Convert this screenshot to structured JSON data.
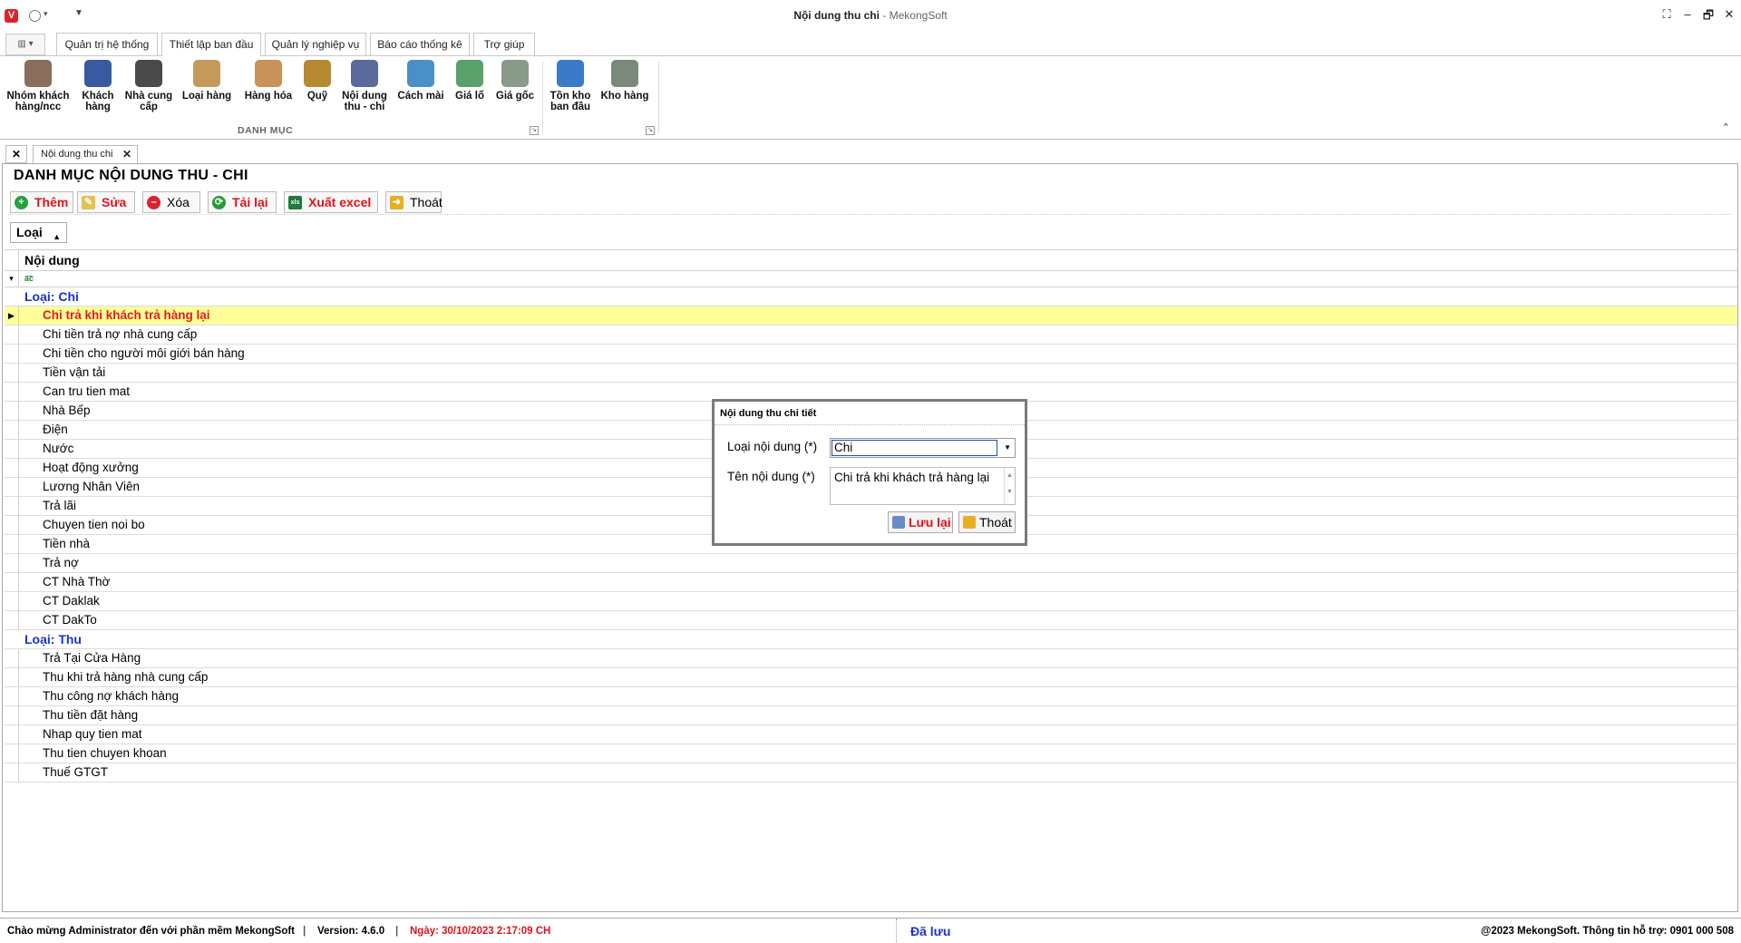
{
  "window": {
    "title": "Nội dung thu chi",
    "app_name": "MekongSoft",
    "separator": " - ",
    "controls": [
      "⛶",
      "–",
      "🗗",
      "✕"
    ]
  },
  "ribbon_tabs": [
    {
      "label": "Quản trị hệ thống"
    },
    {
      "label": "Thiết lập ban đầu",
      "active": true
    },
    {
      "label": "Quản lý nghiệp vụ"
    },
    {
      "label": "Báo cáo thống kê"
    },
    {
      "label": "Trợ giúp"
    }
  ],
  "ribbon": {
    "group_label": "DANH MỤC",
    "buttons": [
      {
        "line1": "Nhóm khách",
        "line2": "hàng/ncc",
        "icon": "people-group-icon",
        "color": "#8a6d5a"
      },
      {
        "line1": "Khách",
        "line2": "hàng",
        "icon": "customer-icon",
        "color": "#3a5aa0"
      },
      {
        "line1": "Nhà cung",
        "line2": "cấp",
        "icon": "supplier-icon",
        "color": "#4a4a4a"
      },
      {
        "line1": "Loại hàng",
        "line2": "",
        "icon": "boxes-icon",
        "color": "#c49a5a"
      },
      {
        "line1": "Hàng hóa",
        "line2": "",
        "icon": "box-icon",
        "color": "#c8925a"
      },
      {
        "line1": "Quỹ",
        "line2": "",
        "icon": "money-bag-icon",
        "color": "#b58a30"
      },
      {
        "line1": "Nội dung",
        "line2": "thu - chi",
        "icon": "notepad-icon",
        "color": "#5a6a9a"
      },
      {
        "line1": "Cách mài",
        "line2": "",
        "icon": "tools-icon",
        "color": "#4a90c8"
      },
      {
        "line1": "Giá lố",
        "line2": "",
        "icon": "banknote-icon",
        "color": "#5aa06a"
      },
      {
        "line1": "Giá gốc",
        "line2": "",
        "icon": "cash-icon",
        "color": "#8a9a8a"
      },
      {
        "line1": "Tồn kho",
        "line2": "ban đầu",
        "icon": "inventory-icon",
        "color": "#3a7ac8"
      },
      {
        "line1": "Kho hàng",
        "line2": "",
        "icon": "warehouse-icon",
        "color": "#7a8a7a"
      }
    ]
  },
  "doc_tab": {
    "label": "Nội dung thu chi"
  },
  "panel": {
    "title": "DANH MỤC NỘI DUNG THU - CHI",
    "toolbar": {
      "add": "Thêm",
      "edit": "Sửa",
      "delete": "Xóa",
      "reload": "Tải lại",
      "export": "Xuất excel",
      "exit": "Thoát"
    },
    "group_by": "Loại",
    "column_header": "Nội dung"
  },
  "groups": [
    {
      "label": "Loại: Chi",
      "rows": [
        "Chi trả khi khách trả hàng lại",
        "Chi tiền trả nợ nhà cung cấp",
        "Chi tiền cho người môi giới bán hàng",
        "Tiền vận tải",
        "Can tru tien mat",
        "Nhà Bếp",
        "Điện",
        "Nước",
        "Hoạt động xưởng",
        "Lương Nhân Viên",
        "Trả lãi",
        "Chuyen tien noi bo",
        "Tiền nhà",
        "Trả nợ",
        "CT Nhà Thờ",
        "CT Daklak",
        "CT DakTo"
      ]
    },
    {
      "label": "Loại: Thu",
      "rows": [
        "Trả Tại Cửa Hàng",
        "Thu khi trả hàng nhà cung cấp",
        "Thu công nợ khách hàng",
        "Thu tiền đặt hàng",
        "Nhap quy tien mat",
        "Thu tien chuyen khoan",
        "Thuế GTGT"
      ]
    }
  ],
  "dialog": {
    "title": "Nội dung thu chi tiết",
    "type_label": "Loại nội dung (*)",
    "type_value": "Chi",
    "name_label": "Tên nội dung (*)",
    "name_value": "Chi trả khi khách trả hàng lại",
    "save": "Lưu lại",
    "exit": "Thoát"
  },
  "status": {
    "welcome": "Chào mừng Administrator đến với phần mềm MekongSoft",
    "version": "Version: 4.6.0",
    "date": "Ngày: 30/10/2023 2:17:09 CH",
    "saved": "Đã lưu",
    "copyright": "@2023 MekongSoft. Thông tin hỗ trợ: 0901 000 508"
  },
  "colors": {
    "selected_row_bg": "#ffff9a",
    "selected_row_text": "#e31b1b",
    "group_text": "#1932cc",
    "date_text": "#e0121b"
  }
}
